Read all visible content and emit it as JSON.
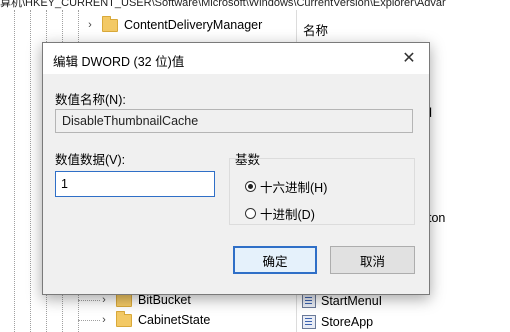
{
  "address_bar": {
    "path": "算机\\HKEY_CURRENT_USER\\Software\\Microsoft\\Windows\\CurrentVersion\\Explorer\\Advar"
  },
  "tree": {
    "top_item": {
      "label": "ContentDeliveryManager"
    },
    "bottom_items": [
      {
        "label": "BitBucket"
      },
      {
        "label": "CabinetState"
      }
    ]
  },
  "values_pane": {
    "column_header": "名称",
    "fragment_1": "d",
    "fragment_2": "ton",
    "items": [
      {
        "label": "StartMenuI"
      },
      {
        "label": "StoreApp"
      }
    ]
  },
  "dialog": {
    "title": "编辑 DWORD (32 位)值",
    "name_label": "数值名称(N):",
    "name_value": "DisableThumbnailCache",
    "data_label": "数值数据(V):",
    "data_value": "1",
    "base_label": "基数",
    "radix_options": [
      {
        "label": "十六进制(H)",
        "selected": true
      },
      {
        "label": "十进制(D)",
        "selected": false
      }
    ],
    "ok_label": "确定",
    "cancel_label": "取消"
  },
  "colors": {
    "accent": "#2f6fc7",
    "folder": "#f3c965",
    "dialog_bg": "#f0f0f0"
  }
}
